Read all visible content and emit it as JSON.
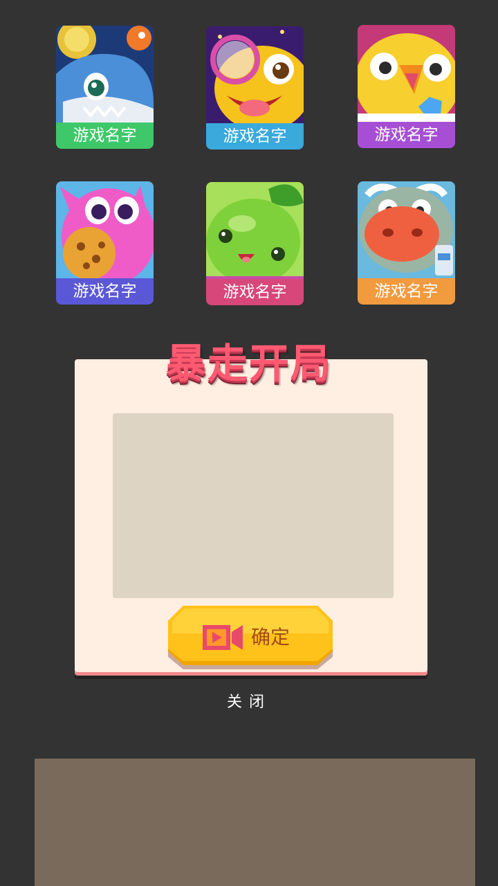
{
  "games": [
    {
      "name": "游戏名字",
      "label_color": "#3fc86a",
      "art": "shark-fish-icon"
    },
    {
      "name": "游戏名字",
      "label_color": "#3aa9dc",
      "art": "yellow-monster-magnifier-icon"
    },
    {
      "name": "游戏名字",
      "label_color": "#a64fd4",
      "art": "yellow-chick-gem-icon"
    },
    {
      "name": "游戏名字",
      "label_color": "#5a58d6",
      "art": "pink-creature-cookie-icon"
    },
    {
      "name": "游戏名字",
      "label_color": "#d7477a",
      "art": "green-slime-icon"
    },
    {
      "name": "游戏名字",
      "label_color": "#f19a3e",
      "art": "cartoon-cow-icon"
    }
  ],
  "dialog": {
    "title": "暴走开局",
    "confirm_label": "确定",
    "close_label": "关闭"
  },
  "colors": {
    "background": "#333333",
    "panel": "#ffeee2",
    "ad_slot": "#ddd4c4",
    "title": "#ff5a72",
    "button": "#ffc21a",
    "banner": "#7a6a5b"
  }
}
